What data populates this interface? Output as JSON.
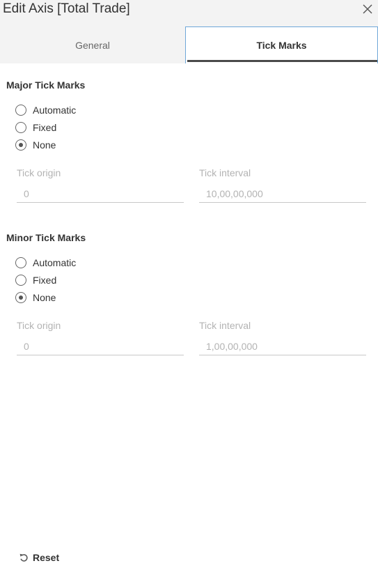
{
  "dialog": {
    "title": "Edit Axis [Total Trade]",
    "close_icon": "close-icon"
  },
  "tabs": [
    {
      "label": "General",
      "active": false
    },
    {
      "label": "Tick Marks",
      "active": true
    }
  ],
  "major": {
    "title": "Major Tick Marks",
    "options": [
      {
        "label": "Automatic",
        "checked": false
      },
      {
        "label": "Fixed",
        "checked": false
      },
      {
        "label": "None",
        "checked": true
      }
    ],
    "tick_origin": {
      "label": "Tick origin",
      "value": "0"
    },
    "tick_interval": {
      "label": "Tick interval",
      "value": "10,00,00,000"
    }
  },
  "minor": {
    "title": "Minor Tick Marks",
    "options": [
      {
        "label": "Automatic",
        "checked": false
      },
      {
        "label": "Fixed",
        "checked": false
      },
      {
        "label": "None",
        "checked": true
      }
    ],
    "tick_origin": {
      "label": "Tick origin",
      "value": "0"
    },
    "tick_interval": {
      "label": "Tick interval",
      "value": "1,00,00,000"
    }
  },
  "footer": {
    "reset_label": "Reset",
    "reset_icon": "undo-icon"
  },
  "colors": {
    "tab_accent_border": "#6ea7d8",
    "disabled_text": "#b3b3b3",
    "header_bg": "#f3f3f3"
  }
}
